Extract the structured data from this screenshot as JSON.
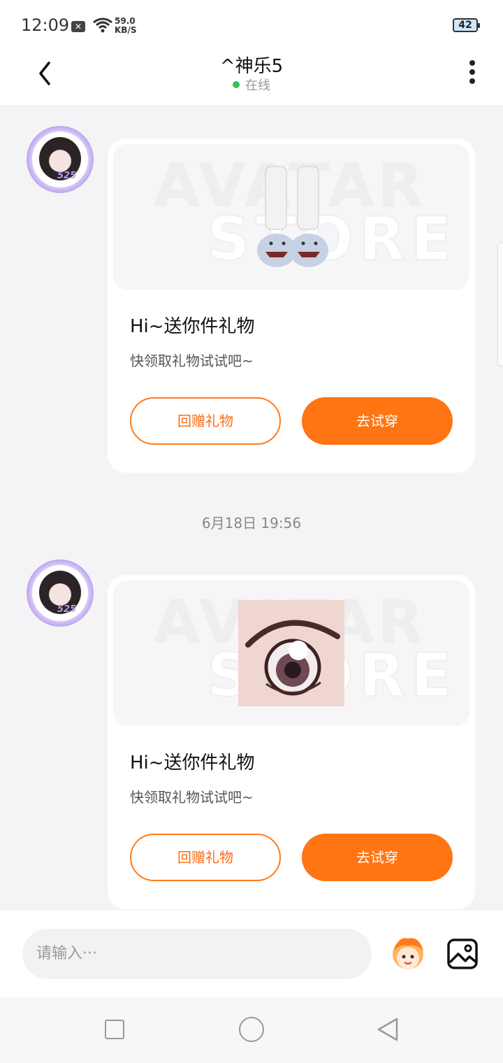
{
  "status_bar": {
    "time": "12:09",
    "speed_value": "59.0",
    "speed_unit": "KB/S",
    "battery": "42"
  },
  "header": {
    "title": "^神乐5",
    "status": "在线",
    "status_color": "#2ec65b"
  },
  "messages": [
    {
      "sender_badge": "525",
      "item_icon": "shark-slippers-icon",
      "watermark_top": "AVATAR",
      "watermark_bottom": "STORE",
      "title": "Hi~送你件礼物",
      "subtitle": "快领取礼物试试吧~",
      "return_gift_label": "回赠礼物",
      "try_on_label": "去试穿"
    },
    {
      "sender_badge": "525",
      "item_icon": "anime-eye-icon",
      "watermark_top": "AVATAR",
      "watermark_bottom": "STORE",
      "title": "Hi~送你件礼物",
      "subtitle": "快领取礼物试试吧~",
      "return_gift_label": "回赠礼物",
      "try_on_label": "去试穿"
    }
  ],
  "timestamp": "6月18日 19:56",
  "input": {
    "placeholder": "请输入···"
  },
  "colors": {
    "accent": "#ff7413",
    "background": "#f4f4f7"
  }
}
